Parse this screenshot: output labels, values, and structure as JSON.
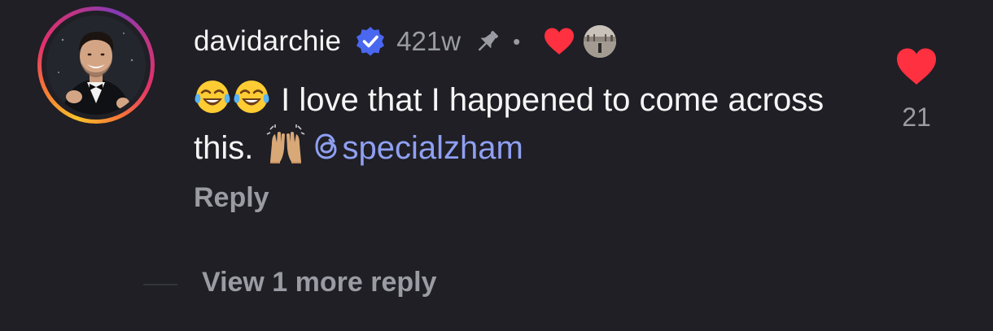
{
  "comment": {
    "username": "davidarchie",
    "verified": true,
    "timestamp": "421w",
    "pinned": true,
    "separator": "•",
    "liked_by_creator": true,
    "text_before_emoji2": " I love that I happened to come across this. ",
    "mention": "specialzham",
    "reply_label": "Reply",
    "like_count": "21",
    "view_more_label": "View 1 more reply"
  },
  "icons": {
    "verified": "verified-badge-icon",
    "pin": "pin-icon",
    "creator_heart": "creator-heart-icon",
    "like": "heart-icon",
    "emoji_laugh": "face-with-tears-of-joy-emoji",
    "emoji_hands": "raising-hands-emoji",
    "threads": "threads-icon"
  },
  "colors": {
    "background": "#1f1f25",
    "text": "#f5f5f5",
    "muted": "#9a9ba3",
    "verified_blue": "#4a67f0",
    "heart_red": "#ff3040",
    "mention": "#8fa0f2"
  }
}
